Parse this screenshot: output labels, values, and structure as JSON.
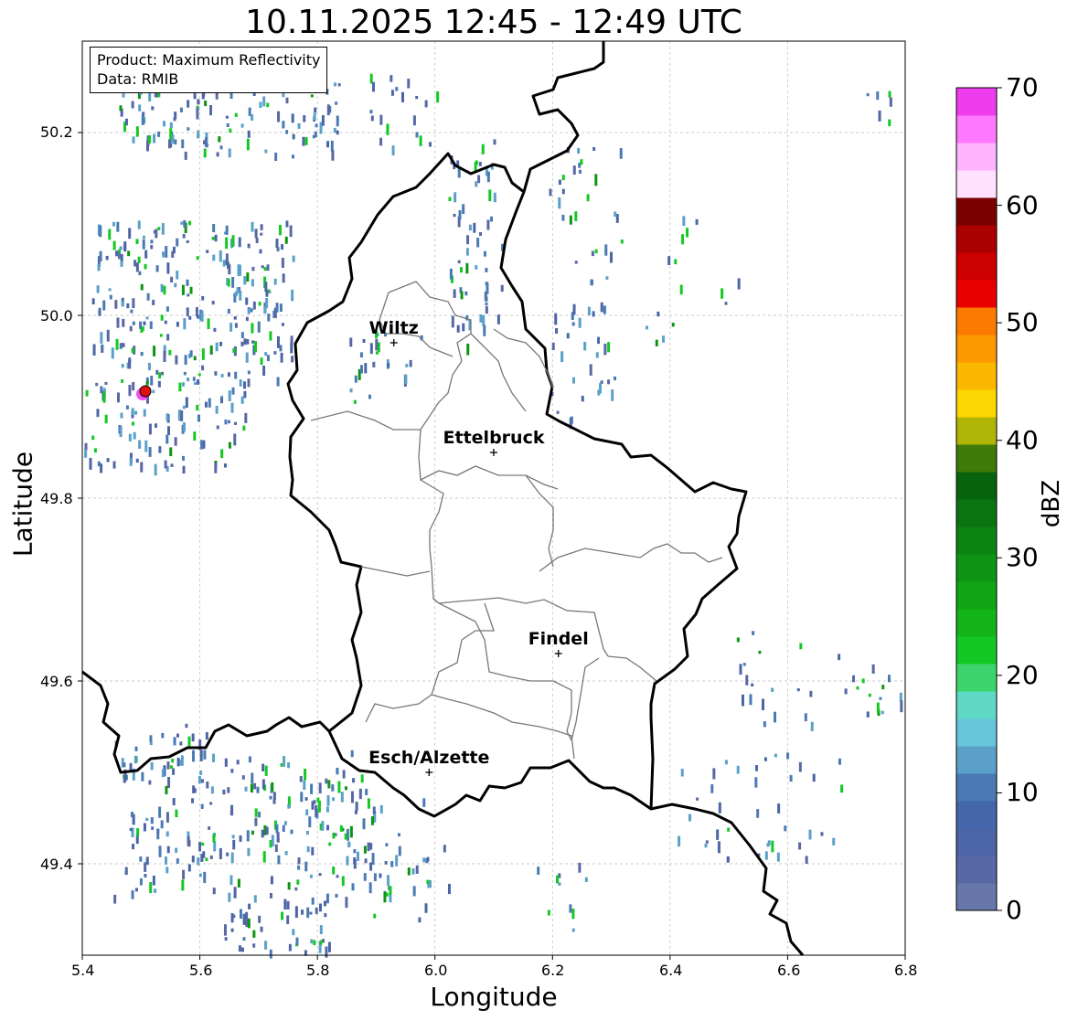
{
  "title": "10.11.2025 12:45 - 12:49 UTC",
  "info": {
    "product": "Product: Maximum Reflectivity",
    "data": "Data: RMIB"
  },
  "axes": {
    "xlabel": "Longitude",
    "ylabel": "Latitude",
    "xticks": [
      "5.4",
      "5.6",
      "5.8",
      "6.0",
      "6.2",
      "6.4",
      "6.6",
      "6.8"
    ],
    "yticks": [
      "50.2",
      "50.0",
      "49.8",
      "49.6",
      "49.4"
    ],
    "xlim": [
      5.4,
      6.8
    ],
    "ylim": [
      49.3,
      50.3
    ]
  },
  "colorbar": {
    "label": "dBZ",
    "ticks": [
      "70",
      "60",
      "50",
      "40",
      "30",
      "20",
      "10",
      "0"
    ],
    "range": [
      0,
      70
    ],
    "colors": [
      "#6777aa",
      "#5768a4",
      "#4c65a6",
      "#4466aa",
      "#4a7ab4",
      "#5aa0c8",
      "#68c4da",
      "#5ed8c4",
      "#3cd46c",
      "#14c824",
      "#12b418",
      "#10a414",
      "#0e9414",
      "#0c8412",
      "#0a7410",
      "#08640c",
      "#407a08",
      "#b0b404",
      "#fcd600",
      "#fcb800",
      "#fc9800",
      "#fc7a00",
      "#e80000",
      "#cc0000",
      "#aa0000",
      "#7a0000",
      "#ffe0ff",
      "#ffb4ff",
      "#ff78ff",
      "#ee3cee"
    ]
  },
  "cities": [
    {
      "name": "Wiltz",
      "lon": 5.93,
      "lat": 49.97
    },
    {
      "name": "Ettelbruck",
      "lon": 6.1,
      "lat": 49.85
    },
    {
      "name": "Findel",
      "lon": 6.21,
      "lat": 49.63
    },
    {
      "name": "Esch/Alzette",
      "lon": 5.99,
      "lat": 49.5
    }
  ],
  "radar_site": {
    "lon": 5.505,
    "lat": 49.915
  }
}
